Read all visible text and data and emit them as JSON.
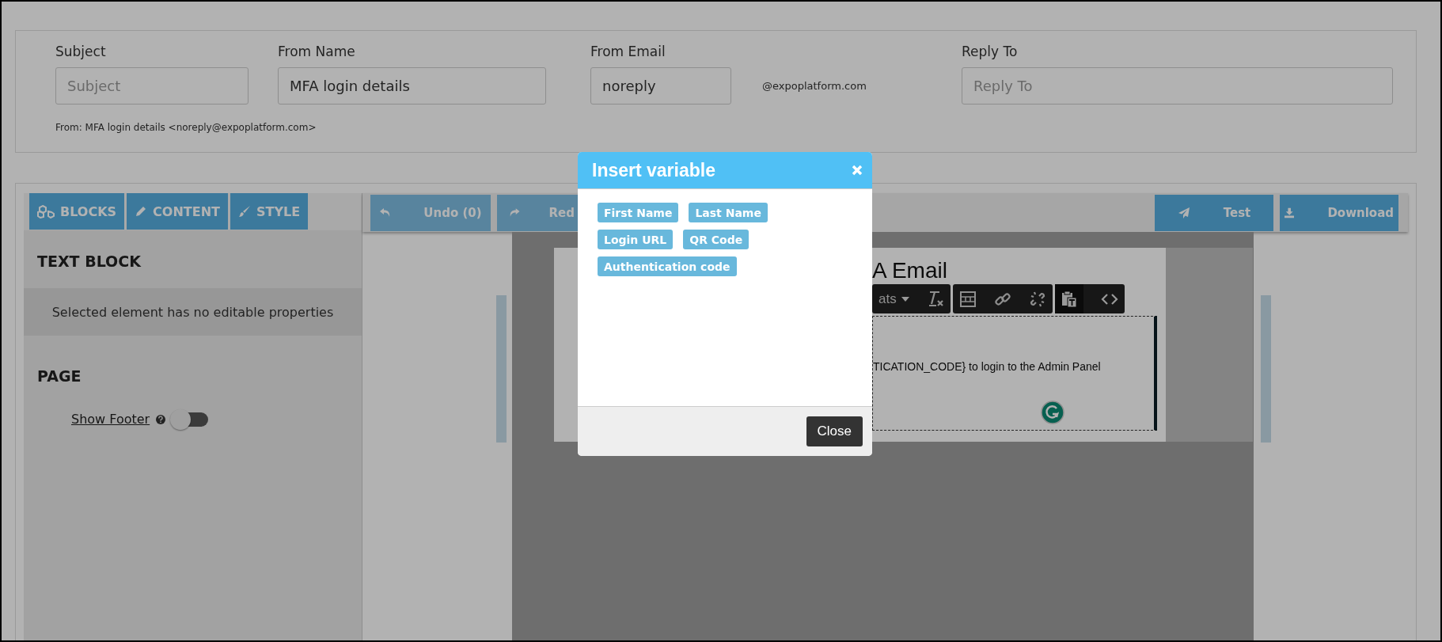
{
  "header_fields": [
    {
      "label": "Subject",
      "placeholder": "Subject"
    },
    {
      "label": "From Name",
      "value": "MFA login details"
    },
    {
      "label": "From Email",
      "value": "noreply",
      "suffix": "@expoplatform.com"
    },
    {
      "label": "Reply To",
      "placeholder": "Reply To"
    }
  ],
  "from_line": "From: MFA login details <noreply@expoplatform.com>",
  "sidebar_tabs": [
    {
      "label": "BLOCKS"
    },
    {
      "label": "CONTENT"
    },
    {
      "label": "STYLE"
    }
  ],
  "text_block": {
    "title": "TEXT BLOCK",
    "message": "Selected element has no editable properties"
  },
  "page_section": {
    "title": "PAGE",
    "toggle": {
      "label": "Show Footer",
      "on": false
    }
  },
  "toolbar": {
    "left": [
      {
        "label": "Undo (0)",
        "disabled": true
      },
      {
        "label": "Red",
        "disabled": true
      }
    ],
    "right": [
      {
        "label": "Test"
      },
      {
        "label": "Download"
      }
    ]
  },
  "email": {
    "title": "A Email",
    "format_label": "ats",
    "body": "TICATION_CODE} to login to the Admin Panel"
  },
  "modal": {
    "title": "Insert variable",
    "variables": [
      "First Name",
      "Last Name",
      "Login URL",
      "QR Code",
      "Authentication code"
    ],
    "close": "Close"
  }
}
